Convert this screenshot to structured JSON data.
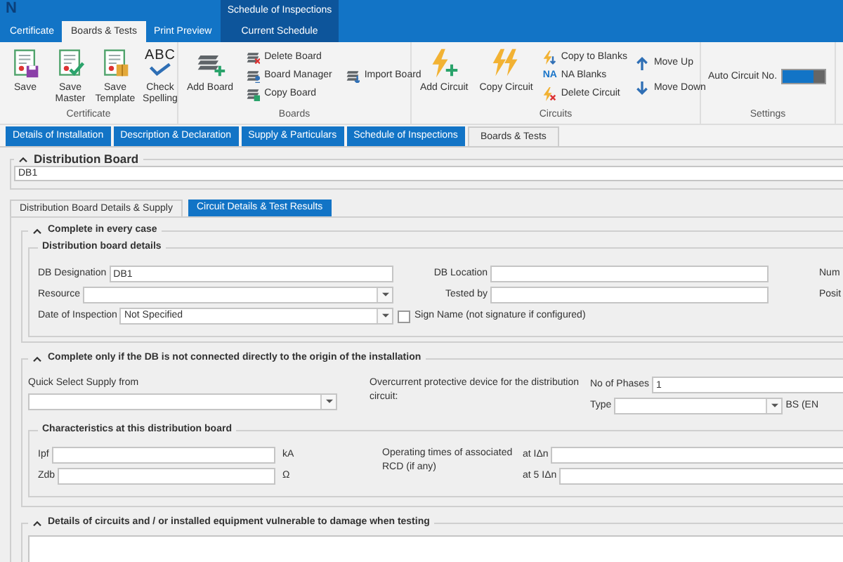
{
  "app": {
    "logo": "N"
  },
  "ribbon_tabs": [
    {
      "label": "Certificate",
      "selected": false
    },
    {
      "label": "Boards & Tests",
      "selected": true
    },
    {
      "label": "Print Preview",
      "selected": false
    }
  ],
  "context_tabs": {
    "title": "Schedule of Inspections",
    "tabs": [
      {
        "label": "Current Schedule",
        "selected": false
      }
    ]
  },
  "ribbon_groups": [
    {
      "title": "Certificate",
      "buttons": [
        {
          "kind": "large",
          "label": "Save"
        },
        {
          "kind": "large",
          "label": "Save Master"
        },
        {
          "kind": "large",
          "label": "Save Template"
        },
        {
          "kind": "large",
          "label": "Check Spelling",
          "icon_text": "ABC"
        }
      ]
    },
    {
      "title": "Boards",
      "buttons": [
        {
          "kind": "large",
          "label": "Add Board"
        },
        {
          "kind": "small",
          "label": "Delete Board"
        },
        {
          "kind": "small",
          "label": "Board Manager"
        },
        {
          "kind": "small",
          "label": "Copy Board"
        },
        {
          "kind": "small",
          "label": "Import Board"
        }
      ]
    },
    {
      "title": "Circuits",
      "buttons": [
        {
          "kind": "large",
          "label": "Add Circuit"
        },
        {
          "kind": "large",
          "label": "Copy Circuit"
        },
        {
          "kind": "small",
          "label": "Copy to Blanks"
        },
        {
          "kind": "small",
          "label": "NA Blanks",
          "icon_text": "NA"
        },
        {
          "kind": "small",
          "label": "Delete Circuit"
        },
        {
          "kind": "small",
          "label": "Move Up"
        },
        {
          "kind": "small",
          "label": "Move Down"
        }
      ]
    },
    {
      "title": "Settings",
      "buttons": [
        {
          "kind": "toggle",
          "label": "Auto Circuit No.",
          "on": true
        }
      ]
    }
  ],
  "page_tabs": [
    {
      "label": "Details of Installation",
      "selected": false
    },
    {
      "label": "Description & Declaration",
      "selected": false
    },
    {
      "label": "Supply & Particulars",
      "selected": false
    },
    {
      "label": "Schedule of Inspections",
      "selected": false
    },
    {
      "label": "Boards & Tests",
      "selected": true
    }
  ],
  "distribution_board": {
    "title": "Distribution Board",
    "expanded": true,
    "value": "DB1"
  },
  "sub_tabs": [
    {
      "label": "Distribution Board Details & Supply",
      "selected": true
    },
    {
      "label": "Circuit Details & Test Results",
      "selected": false
    }
  ],
  "section_every_case": {
    "title": "Complete in every case",
    "expanded": true,
    "group_title": "Distribution board details",
    "left_fields": [
      {
        "kind": "text",
        "label": "DB Designation",
        "value": "DB1"
      },
      {
        "kind": "dropdown",
        "label": "Resource"
      },
      {
        "kind": "dropdown",
        "label": "Date of Inspection",
        "value": "Not Specified"
      }
    ],
    "middle_fields": [
      {
        "kind": "text",
        "label": "DB Location"
      },
      {
        "kind": "text",
        "label": "Tested by"
      }
    ],
    "sign_name": {
      "label": "Sign Name (not signature if configured)",
      "checked": false
    },
    "right_labels": [
      "Num",
      "Posit"
    ]
  },
  "section_not_origin": {
    "title": "Complete only if the DB is not connected directly to the origin of the installation",
    "expanded": true,
    "quick_select": {
      "label": "Quick Select Supply from"
    },
    "overcurrent_label": "Overcurrent protective device for the distribution circuit:",
    "phases": {
      "label": "No of Phases",
      "value": "1"
    },
    "type": {
      "label": "Type",
      "suffix": "BS (EN"
    },
    "group_title": "Characteristics at this distribution board",
    "characteristics": [
      {
        "label": "Ipf",
        "unit": "kA"
      },
      {
        "label": "Zdb",
        "unit": "Ω"
      }
    ],
    "rcd_label": "Operating times of associated RCD (if any)",
    "rcd_fields": [
      {
        "label": "at IΔn"
      },
      {
        "label": "at 5 IΔn"
      }
    ]
  },
  "section_vulnerable": {
    "title": "Details of circuits and / or installed equipment vulnerable to damage when testing",
    "expanded": true
  }
}
